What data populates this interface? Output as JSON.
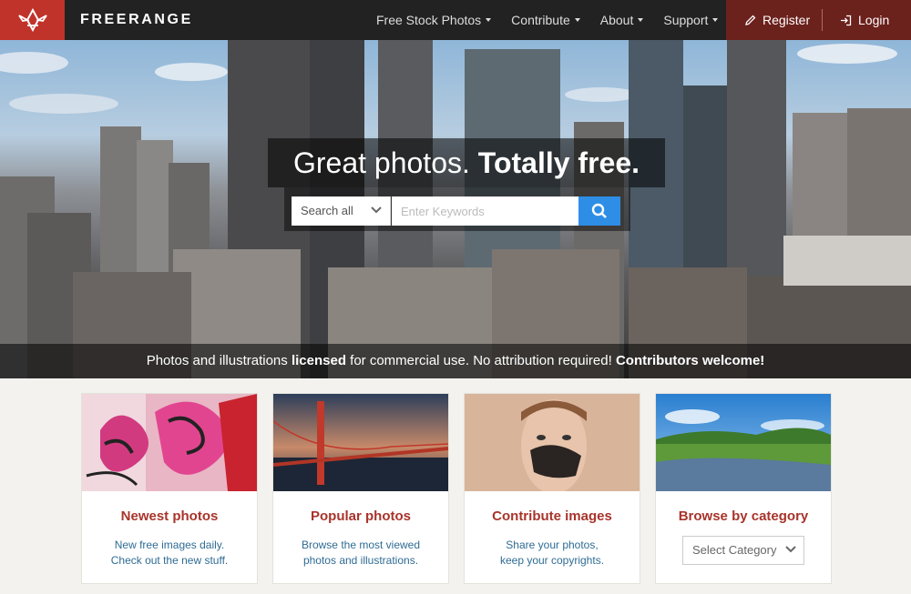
{
  "brand": {
    "name": "FREERANGE",
    "logo_color": "#c0332a"
  },
  "nav": {
    "items": [
      {
        "label": "Free Stock Photos"
      },
      {
        "label": "Contribute"
      },
      {
        "label": "About"
      },
      {
        "label": "Support"
      }
    ],
    "register_label": "Register",
    "login_label": "Login"
  },
  "hero": {
    "title_light": "Great photos.",
    "title_bold": "Totally free.",
    "search": {
      "select_value": "Search all",
      "placeholder": "Enter Keywords",
      "button_color": "#2e8ee6"
    },
    "tagline": {
      "part1": "Photos and illustrations ",
      "bold1": "licensed",
      "part2": " for commercial use. No attribution required! ",
      "bold2": "Contributors welcome!"
    }
  },
  "cards": [
    {
      "title": "Newest photos",
      "line1": "New free images daily.",
      "line2": "Check out the new stuff."
    },
    {
      "title": "Popular photos",
      "line1": "Browse the most viewed",
      "line2": "photos and illustrations."
    },
    {
      "title": "Contribute images",
      "line1": "Share your photos,",
      "line2": "keep your copyrights."
    },
    {
      "title": "Browse by category",
      "select_value": "Select Category"
    }
  ],
  "colors": {
    "nav_bg": "#222222",
    "auth_bg": "#6b211c",
    "title_red": "#a8342b",
    "link_blue": "#2f6c94"
  }
}
